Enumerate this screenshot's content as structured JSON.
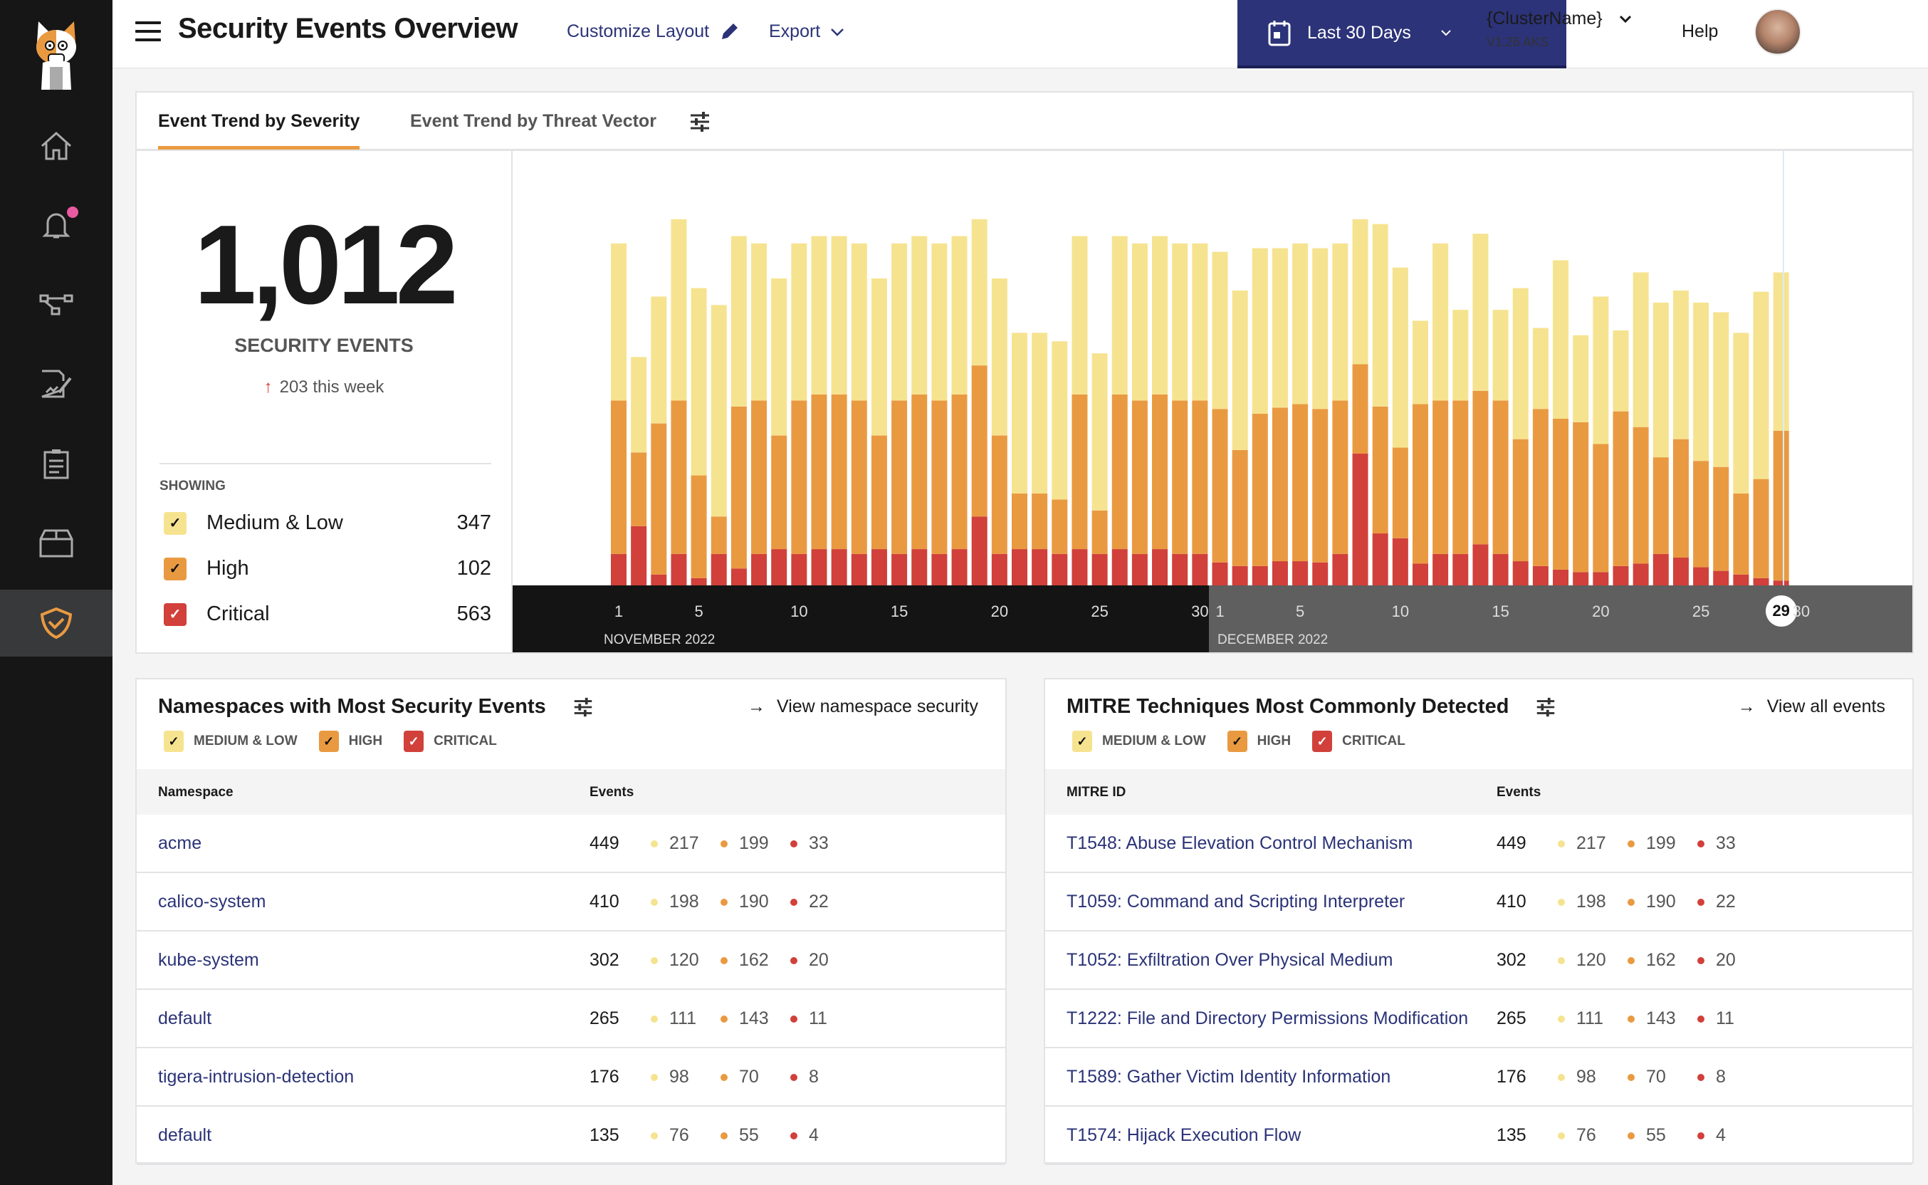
{
  "colors": {
    "medium_low": "#f6e390",
    "high": "#e99a41",
    "critical": "#d1403a",
    "accent_blue": "#2c3379",
    "link": "#2b3378",
    "notification": "#ea5aa2"
  },
  "sidebar": {
    "items": [
      {
        "name": "home",
        "icon": "home-icon"
      },
      {
        "name": "alerts",
        "icon": "bell-icon",
        "has_notification": true
      },
      {
        "name": "topology",
        "icon": "network-icon"
      },
      {
        "name": "policies",
        "icon": "document-edit-icon"
      },
      {
        "name": "compliance",
        "icon": "clipboard-icon"
      },
      {
        "name": "inventory",
        "icon": "box-icon"
      },
      {
        "name": "security",
        "icon": "shield-check-icon",
        "active": true
      }
    ]
  },
  "header": {
    "title": "Security Events Overview",
    "customize_label": "Customize Layout",
    "export_label": "Export",
    "date_range": "Last 30 Days",
    "cluster_name": "{ClusterName}",
    "cluster_version": "V1.26 AKS",
    "help_label": "Help"
  },
  "trend": {
    "tabs": [
      {
        "label": "Event Trend by Severity",
        "active": true
      },
      {
        "label": "Event Trend by Threat Vector",
        "active": false
      }
    ],
    "total": "1,012",
    "total_label": "SECURITY EVENTS",
    "week_change": "203 this week",
    "showing_label": "SHOWING",
    "legend": [
      {
        "label": "Medium & Low",
        "count": "347",
        "key": "medium_low",
        "checked": true
      },
      {
        "label": "High",
        "count": "102",
        "key": "high",
        "checked": true
      },
      {
        "label": "Critical",
        "count": "563",
        "key": "critical",
        "checked": true
      }
    ]
  },
  "chart_data": {
    "type": "bar",
    "stacked": true,
    "title": "Event Trend by Severity",
    "xlabel": "",
    "ylabel": "",
    "ylim": [
      0,
      330
    ],
    "grid": false,
    "months": [
      {
        "label": "NOVEMBER 2022",
        "days": 30,
        "ticks": [
          "1",
          "5",
          "10",
          "15",
          "20",
          "25",
          "30"
        ]
      },
      {
        "label": "DECEMBER 2022",
        "days": 30,
        "ticks": [
          "1",
          "5",
          "10",
          "15",
          "20",
          "25",
          "29",
          "30"
        ]
      }
    ],
    "highlighted_day": "29",
    "series": [
      {
        "name": "Critical",
        "key": "critical",
        "values": [
          26,
          49,
          9,
          26,
          6,
          26,
          14,
          26,
          30,
          26,
          30,
          30,
          26,
          30,
          26,
          30,
          26,
          30,
          57,
          26,
          30,
          30,
          26,
          30,
          26,
          30,
          26,
          30,
          26,
          26,
          19,
          16,
          16,
          20,
          20,
          19,
          26,
          109,
          43,
          39,
          18,
          26,
          26,
          34,
          26,
          20,
          16,
          13,
          11,
          11,
          16,
          18,
          26,
          23,
          15,
          12,
          9,
          6,
          4
        ]
      },
      {
        "name": "High",
        "key": "high",
        "values": [
          127,
          61,
          125,
          127,
          85,
          31,
          134,
          127,
          94,
          127,
          128,
          128,
          127,
          94,
          127,
          128,
          127,
          128,
          125,
          98,
          46,
          46,
          45,
          128,
          36,
          128,
          127,
          128,
          127,
          127,
          127,
          96,
          126,
          127,
          130,
          127,
          127,
          74,
          105,
          75,
          132,
          127,
          127,
          127,
          127,
          101,
          130,
          125,
          124,
          106,
          128,
          113,
          80,
          98,
          88,
          86,
          67,
          82,
          124
        ]
      },
      {
        "name": "Medium & Low",
        "key": "medium_low",
        "values": [
          130,
          79,
          105,
          150,
          155,
          175,
          141,
          130,
          130,
          130,
          131,
          131,
          130,
          130,
          130,
          131,
          130,
          131,
          121,
          130,
          133,
          133,
          131,
          131,
          130,
          131,
          130,
          131,
          130,
          130,
          130,
          132,
          137,
          132,
          133,
          133,
          130,
          120,
          151,
          149,
          69,
          130,
          75,
          130,
          75,
          125,
          67,
          131,
          72,
          122,
          67,
          128,
          128,
          123,
          131,
          128,
          133,
          155,
          131
        ]
      }
    ],
    "categories": [
      "Nov 1",
      "Nov 2",
      "Nov 3",
      "Nov 4",
      "Nov 5",
      "Nov 6",
      "Nov 7",
      "Nov 8",
      "Nov 9",
      "Nov 10",
      "Nov 11",
      "Nov 12",
      "Nov 13",
      "Nov 14",
      "Nov 15",
      "Nov 16",
      "Nov 17",
      "Nov 18",
      "Nov 19",
      "Nov 20",
      "Nov 21",
      "Nov 22",
      "Nov 23",
      "Nov 24",
      "Nov 25",
      "Nov 26",
      "Nov 27",
      "Nov 28",
      "Nov 29",
      "Nov 30",
      "Dec 1",
      "Dec 2",
      "Dec 3",
      "Dec 4",
      "Dec 5",
      "Dec 6",
      "Dec 7",
      "Dec 8",
      "Dec 9",
      "Dec 10",
      "Dec 11",
      "Dec 12",
      "Dec 13",
      "Dec 14",
      "Dec 15",
      "Dec 16",
      "Dec 17",
      "Dec 18",
      "Dec 19",
      "Dec 20",
      "Dec 21",
      "Dec 22",
      "Dec 23",
      "Dec 24",
      "Dec 25",
      "Dec 26",
      "Dec 27",
      "Dec 28",
      "Dec 29"
    ]
  },
  "namespaces": {
    "title": "Namespaces with Most Security Events",
    "link": "View namespace security",
    "legend": [
      "MEDIUM & LOW",
      "HIGH",
      "CRITICAL"
    ],
    "columns": [
      "Namespace",
      "Events"
    ],
    "rows": [
      {
        "name": "acme",
        "total": "449",
        "medium_low": "217",
        "high": "199",
        "critical": "33"
      },
      {
        "name": "calico-system",
        "total": "410",
        "medium_low": "198",
        "high": "190",
        "critical": "22"
      },
      {
        "name": "kube-system",
        "total": "302",
        "medium_low": "120",
        "high": "162",
        "critical": "20"
      },
      {
        "name": "default",
        "total": "265",
        "medium_low": "111",
        "high": "143",
        "critical": "11"
      },
      {
        "name": "tigera-intrusion-detection",
        "total": "176",
        "medium_low": "98",
        "high": "70",
        "critical": "8"
      },
      {
        "name": "default",
        "total": "135",
        "medium_low": "76",
        "high": "55",
        "critical": "4"
      }
    ]
  },
  "mitre": {
    "title": "MITRE Techniques Most Commonly Detected",
    "link": "View all events",
    "legend": [
      "MEDIUM & LOW",
      "HIGH",
      "CRITICAL"
    ],
    "columns": [
      "MITRE ID",
      "Events"
    ],
    "rows": [
      {
        "name": "T1548: Abuse Elevation Control Mechanism",
        "total": "449",
        "medium_low": "217",
        "high": "199",
        "critical": "33"
      },
      {
        "name": "T1059: Command and Scripting Interpreter",
        "total": "410",
        "medium_low": "198",
        "high": "190",
        "critical": "22"
      },
      {
        "name": "T1052: Exfiltration Over Physical Medium",
        "total": "302",
        "medium_low": "120",
        "high": "162",
        "critical": "20"
      },
      {
        "name": "T1222: File and Directory Permissions Modification",
        "total": "265",
        "medium_low": "111",
        "high": "143",
        "critical": "11"
      },
      {
        "name": "T1589: Gather Victim Identity Information",
        "total": "176",
        "medium_low": "98",
        "high": "70",
        "critical": "8"
      },
      {
        "name": "T1574: Hijack Execution Flow",
        "total": "135",
        "medium_low": "76",
        "high": "55",
        "critical": "4"
      }
    ]
  }
}
